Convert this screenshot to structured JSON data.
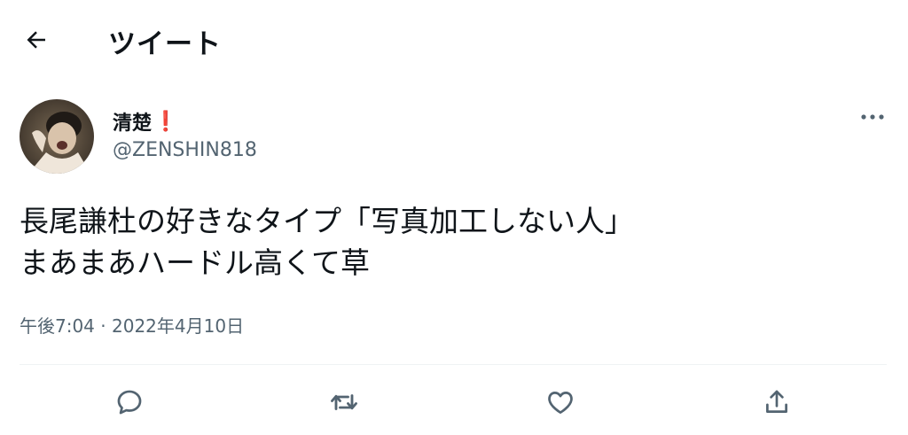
{
  "header": {
    "title": "ツイート",
    "back_icon": "arrow-left-icon"
  },
  "author": {
    "name": "清楚",
    "name_emoji": "❗",
    "handle": "@ZENSHIN818",
    "more_icon": "more-horizontal-icon"
  },
  "tweet": {
    "lines": [
      "長尾謙杜の好きなタイプ「写真加工しない人」",
      "まあまあハードル高くて草"
    ],
    "time": "午後7:04",
    "separator": "·",
    "date": "2022年4月10日"
  },
  "actions": [
    {
      "name": "reply",
      "icon": "reply-icon"
    },
    {
      "name": "retweet",
      "icon": "retweet-icon"
    },
    {
      "name": "like",
      "icon": "heart-icon"
    },
    {
      "name": "share",
      "icon": "share-icon"
    }
  ],
  "colors": {
    "text": "#0f1419",
    "secondary": "#536471",
    "divider": "#eff3f4",
    "accent_red": "#e0245e"
  }
}
